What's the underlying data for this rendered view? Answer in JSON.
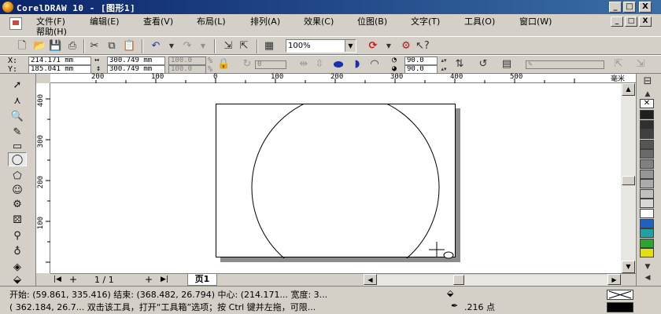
{
  "window": {
    "title": "CorelDRAW 10 - [图形1]"
  },
  "title_controls": {
    "minimize": "_",
    "maximize": "□",
    "close": "X"
  },
  "menu": {
    "items": [
      "文件(F)",
      "编辑(E)",
      "查看(V)",
      "布局(L)",
      "排列(A)",
      "效果(C)",
      "位图(B)",
      "文字(T)",
      "工具(O)",
      "窗口(W)",
      "帮助(H)"
    ]
  },
  "toolbar": {
    "zoom_value": "100%"
  },
  "property_bar": {
    "x_label": "X:",
    "x_value": "214.171 mm",
    "y_label": "Y:",
    "y_value": "185.041 mm",
    "width_value": "300.749 mm",
    "height_value": "300.749 mm",
    "scale_x": "100.0",
    "scale_y": "100.0",
    "rotation": "0",
    "pct": "%",
    "start_angle": "90.0",
    "end_angle": "90.0"
  },
  "ruler": {
    "h_labels": [
      "200",
      "100",
      "0",
      "100",
      "200",
      "300",
      "400",
      "500"
    ],
    "unit": "毫米",
    "v_labels": [
      "400",
      "300",
      "200",
      "100"
    ]
  },
  "page_nav": {
    "counter": "1 / 1",
    "tab_label": "页1"
  },
  "palette": {
    "colors": [
      "#202020",
      "#303030",
      "#404040",
      "#555555",
      "#6a6a6a",
      "#808080",
      "#969696",
      "#ababab",
      "#c0c0c0",
      "#d8d8d8",
      "#ffffff",
      "#2060c0",
      "#20a0a0",
      "#30a030",
      "#e0e010"
    ]
  },
  "status": {
    "line1": "开始: (59.861, 335.416) 结束: (368.482, 26.794)  中心: (214.171...  宽度: 3...",
    "line2": "( 362.184, 26.7...  双击该工具，打开“工具箱”选项；按 Ctrl 键并左拖，可限...",
    "line2_tail": ".216 点"
  }
}
